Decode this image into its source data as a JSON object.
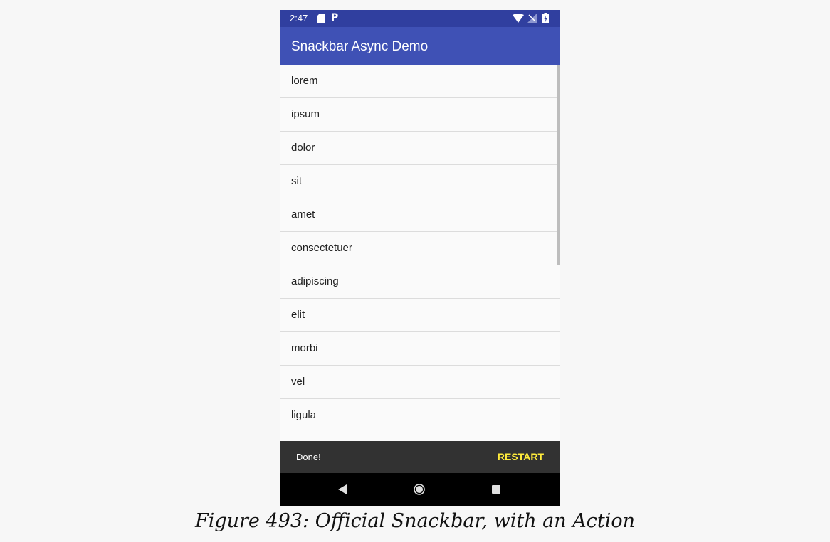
{
  "status_bar": {
    "time": "2:47",
    "icons": [
      "sd-card-icon",
      "parking-icon",
      "wifi-icon",
      "signal-icon",
      "battery-charging-icon"
    ]
  },
  "app_bar": {
    "title": "Snackbar Async Demo"
  },
  "list": {
    "items": [
      "lorem",
      "ipsum",
      "dolor",
      "sit",
      "amet",
      "consectetuer",
      "adipiscing",
      "elit",
      "morbi",
      "vel",
      "ligula"
    ]
  },
  "snackbar": {
    "message": "Done!",
    "action_label": "RESTART"
  },
  "nav_bar": {
    "icons": [
      "back-icon",
      "home-icon",
      "recents-icon"
    ]
  },
  "caption": "Figure 493: Official Snackbar, with an Action",
  "colors": {
    "status_bar": "#303f9f",
    "app_bar": "#3f51b5",
    "snackbar": "#323232",
    "snackbar_action": "#ffeb3b",
    "nav_bar": "#000000"
  }
}
